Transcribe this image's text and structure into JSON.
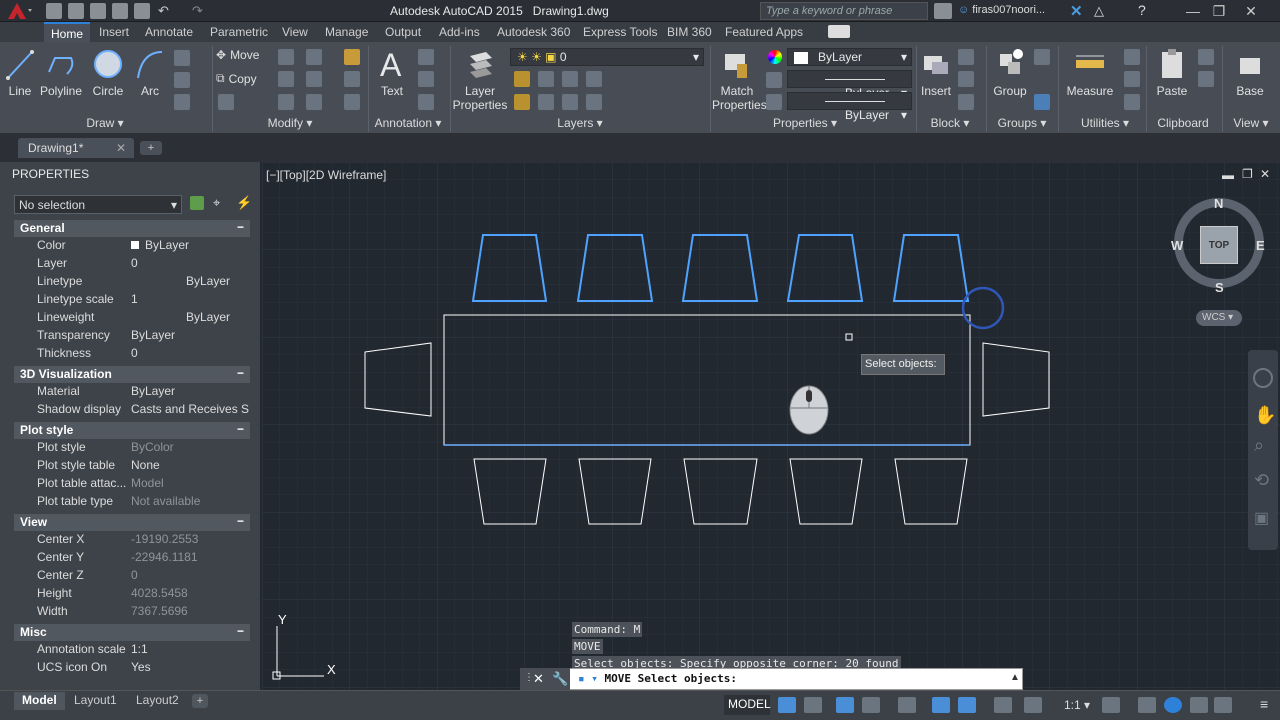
{
  "titlebar": {
    "app_title": "Autodesk AutoCAD 2015",
    "doc_title": "Drawing1.dwg",
    "search_placeholder": "Type a keyword or phrase",
    "user": "firas007noori..."
  },
  "ribbon_tabs": [
    "Home",
    "Insert",
    "Annotate",
    "Parametric",
    "View",
    "Manage",
    "Output",
    "Add-ins",
    "Autodesk 360",
    "Express Tools",
    "BIM 360",
    "Featured Apps"
  ],
  "draw": {
    "line": "Line",
    "polyline": "Polyline",
    "circle": "Circle",
    "arc": "Arc",
    "title": "Draw"
  },
  "modify": {
    "move": "Move",
    "copy": "Copy",
    "title": "Modify"
  },
  "annotation": {
    "text": "Text",
    "title": "Annotation"
  },
  "layers": {
    "layer_properties_1": "Layer",
    "layer_properties_2": "Properties",
    "current_layer": "0",
    "title": "Layers"
  },
  "properties_panel": {
    "match_1": "Match",
    "match_2": "Properties",
    "color": "ByLayer",
    "linetype": "ByLayer",
    "lineweight": "ByLayer",
    "title": "Properties"
  },
  "block": {
    "insert": "Insert",
    "title": "Block"
  },
  "groups": {
    "group": "Group",
    "title": "Groups"
  },
  "utilities": {
    "measure": "Measure",
    "title": "Utilities"
  },
  "clipboard": {
    "paste": "Paste",
    "title": "Clipboard"
  },
  "view_panel": {
    "base": "Base",
    "title": "View"
  },
  "doc_tab": "Drawing1*",
  "palette": {
    "title": "PROPERTIES",
    "selection": "No selection",
    "sections": [
      {
        "name": "General",
        "rows": [
          [
            "Color",
            "ByLayer"
          ],
          [
            "Layer",
            "0"
          ],
          [
            "Linetype",
            "ByLayer"
          ],
          [
            "Linetype scale",
            "1"
          ],
          [
            "Lineweight",
            "ByLayer"
          ],
          [
            "Transparency",
            "ByLayer"
          ],
          [
            "Thickness",
            "0"
          ]
        ]
      },
      {
        "name": "3D Visualization",
        "rows": [
          [
            "Material",
            "ByLayer"
          ],
          [
            "Shadow display",
            "Casts and Receives S..."
          ]
        ]
      },
      {
        "name": "Plot style",
        "rows": [
          [
            "Plot style",
            "ByColor"
          ],
          [
            "Plot style table",
            "None"
          ],
          [
            "Plot table attac...",
            "Model"
          ],
          [
            "Plot table type",
            "Not available"
          ]
        ]
      },
      {
        "name": "View",
        "rows": [
          [
            "Center X",
            "-19190.2553"
          ],
          [
            "Center Y",
            "-22946.1181"
          ],
          [
            "Center Z",
            "0"
          ],
          [
            "Height",
            "4028.5458"
          ],
          [
            "Width",
            "7367.5696"
          ]
        ]
      },
      {
        "name": "Misc",
        "rows": [
          [
            "Annotation scale",
            "1:1"
          ],
          [
            "UCS icon On",
            "Yes"
          ]
        ]
      }
    ]
  },
  "viewport": {
    "label": "[−][Top][2D Wireframe]",
    "tooltip": "Select objects:",
    "viewcube": {
      "n": "N",
      "s": "S",
      "e": "E",
      "w": "W",
      "top": "TOP",
      "wcs": "WCS"
    },
    "ucs_x": "X",
    "ucs_y": "Y"
  },
  "command": {
    "history": [
      "Command: M",
      "MOVE",
      "Select objects: Specify opposite corner: 20 found"
    ],
    "current": "MOVE Select objects:"
  },
  "layout_tabs": [
    "Model",
    "Layout1",
    "Layout2"
  ],
  "status": {
    "model": "MODEL",
    "scale": "1:1"
  },
  "colors": {
    "accent": "#2e81d8",
    "selection": "#4fa3ff",
    "background": "#212830"
  }
}
